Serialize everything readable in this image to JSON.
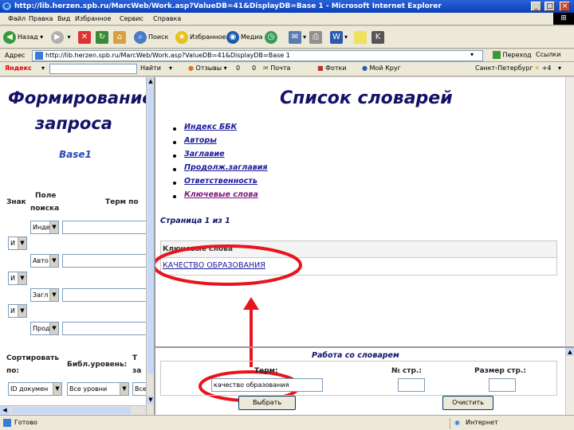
{
  "window": {
    "title": "http://lib.herzen.spb.ru/MarcWeb/Work.asp?ValueDB=41&DisplayDB=Base 1 - Microsoft Internet Explorer",
    "min_label": "_",
    "max_label": "□",
    "close_label": "×"
  },
  "menu": {
    "items": [
      "Файл",
      "Правка",
      "Вид",
      "Избранное",
      "Сервис",
      "Справка"
    ]
  },
  "toolbar": {
    "back_label": "Назад",
    "search_label": "Поиск",
    "favorites_label": "Избранное",
    "media_label": "Медиа"
  },
  "address": {
    "label": "Адрес",
    "url": "http://lib.herzen.spb.ru/MarcWeb/Work.asp?ValueDB=41&DisplayDB=Base 1",
    "go_label": "Переход",
    "links_label": "Ссылки"
  },
  "yandex": {
    "logo": "Яндекс",
    "find_label": "Найти",
    "reviews_label": "Отзывы",
    "count1": "0",
    "count2": "0",
    "mail_label": "Почта",
    "photo_label": "Фотки",
    "my_circle_label": "Мой Круг",
    "city": "Санкт-Петербург",
    "temp": "+4"
  },
  "left": {
    "title_line1": "Формирование",
    "title_line2": "запроса",
    "base_name": "Base1",
    "col_sign": "Знак",
    "col_field_line1": "Поле",
    "col_field_line2": "поиска",
    "col_term": "Терм по",
    "rows": [
      {
        "op": "",
        "field": "Инде"
      },
      {
        "op": "И",
        "field": "Авто"
      },
      {
        "op": "И",
        "field": "Загл"
      },
      {
        "op": "И",
        "field": "Прод"
      }
    ],
    "sort_label_line1": "Сортировать",
    "sort_label_line2": "по:",
    "level_label": "Библ.уровень:",
    "third_label_line1": "Т",
    "third_label_line2": "за",
    "sort_value": "ID докумен",
    "level_value": "Все уровни",
    "third_value": "Все"
  },
  "right": {
    "title": "Список словарей",
    "dictionaries": [
      "Индекс ББК",
      "Авторы",
      "Заглавие",
      "Продолж.заглавия",
      "Ответственность",
      "Ключевые слова"
    ],
    "page_info": "Страница 1 из 1",
    "table_header": "Ключевые слова",
    "table_value": "КАЧЕСТВО ОБРАЗОВАНИЯ"
  },
  "bottom": {
    "title": "Работа со словарем",
    "term_label": "Терм:",
    "page_no_label": "№ стр.:",
    "page_size_label": "Размер стр.:",
    "term_value": "качество образования",
    "page_no_value": "",
    "page_size_value": "",
    "select_label": "Выбрать",
    "clear_label": "Очистить"
  },
  "status": {
    "left": "Готово",
    "zone": "Интернет"
  },
  "colors": {
    "annotation_red": "#e8141e",
    "title_navy": "#121268",
    "link_blue": "#1a1a9a",
    "link_visited": "#7a1a7a"
  }
}
